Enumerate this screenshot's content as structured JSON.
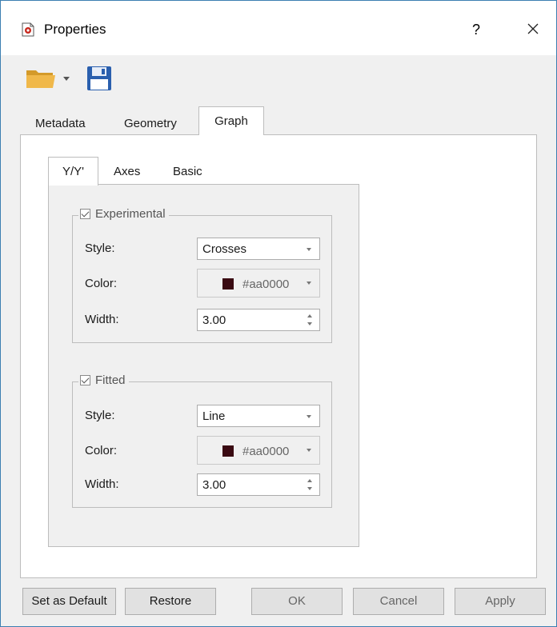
{
  "window": {
    "title": "Properties",
    "help": "?",
    "close": "✕"
  },
  "toolbar": {
    "open_icon": "folder-open-icon",
    "save_icon": "floppy-disk-icon"
  },
  "tabs": [
    {
      "label": "Metadata"
    },
    {
      "label": "Geometry"
    },
    {
      "label": "Graph",
      "active": true
    }
  ],
  "inner_tabs": [
    {
      "label": "Y/Y'",
      "active": true
    },
    {
      "label": "Axes"
    },
    {
      "label": "Basic"
    }
  ],
  "experimental": {
    "title": "Experimental",
    "checked": true,
    "style_label": "Style:",
    "style_value": "Crosses",
    "color_label": "Color:",
    "color_value": "#aa0000",
    "width_label": "Width:",
    "width_value": "3.00"
  },
  "fitted": {
    "title": "Fitted",
    "checked": true,
    "style_label": "Style:",
    "style_value": "Line",
    "color_label": "Color:",
    "color_value": "#aa0000",
    "width_label": "Width:",
    "width_value": "3.00"
  },
  "buttons": {
    "set_default": "Set as Default",
    "restore": "Restore",
    "ok": "OK",
    "cancel": "Cancel",
    "apply": "Apply"
  },
  "colors": {
    "accent_border": "#3c7fb1",
    "swatch": "#3a0a12"
  }
}
